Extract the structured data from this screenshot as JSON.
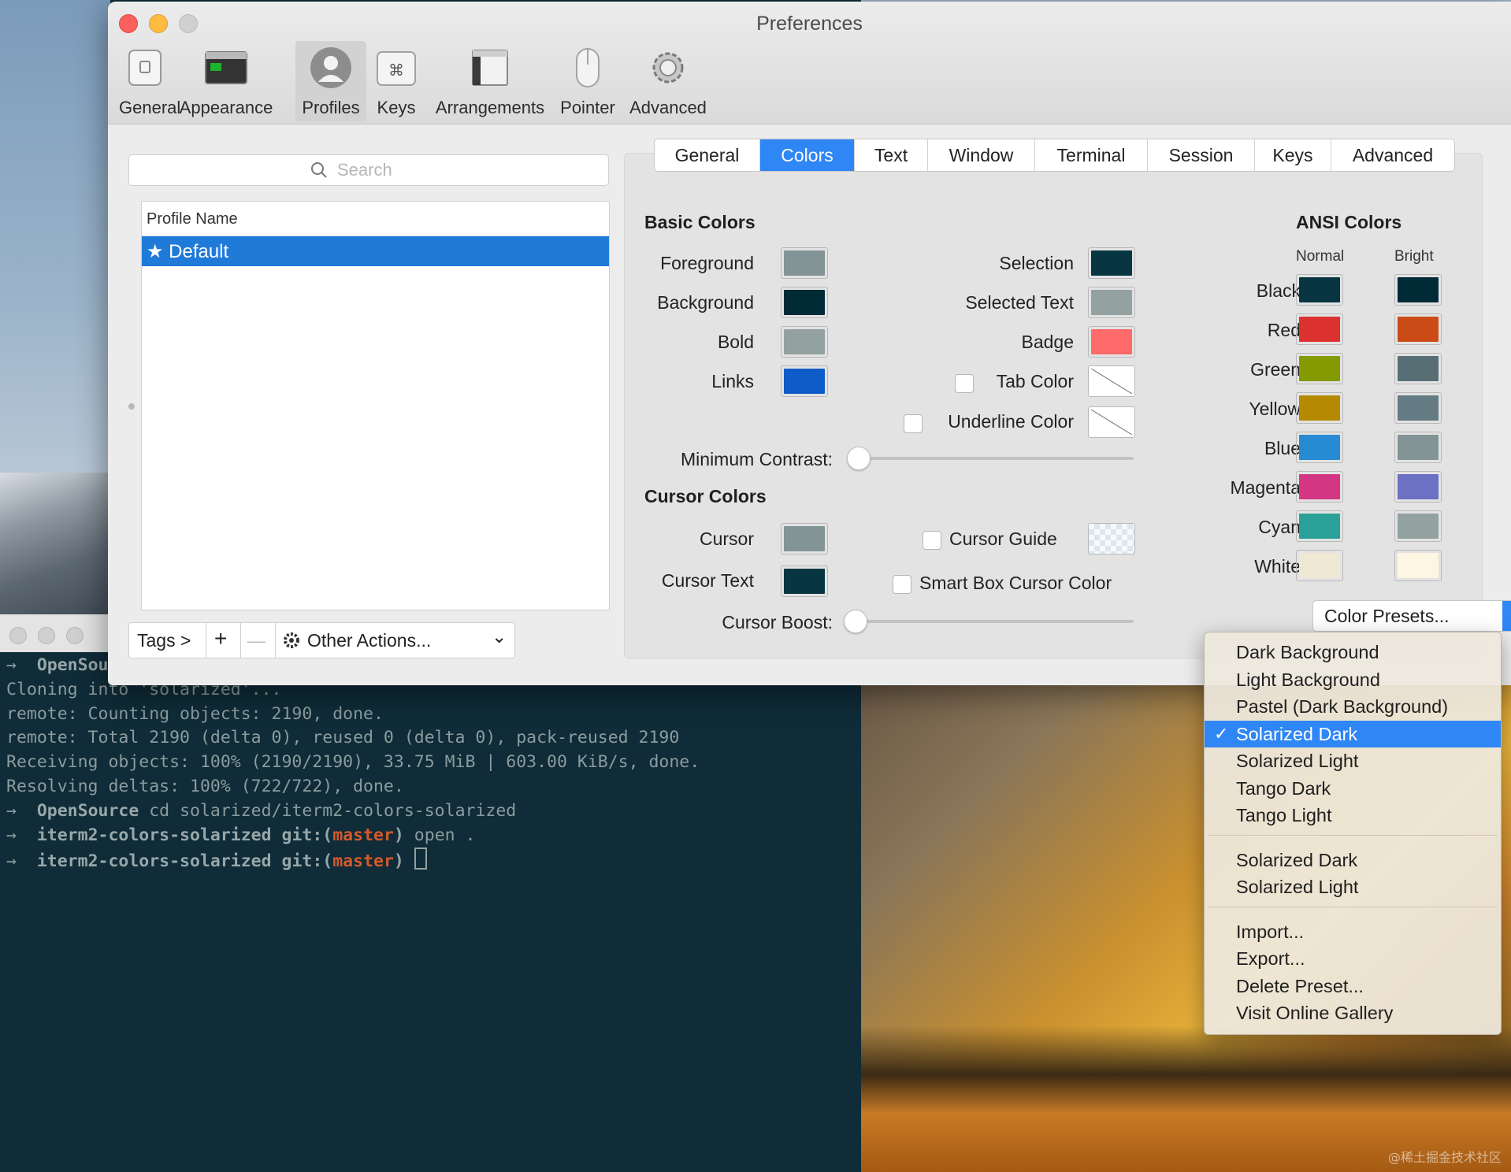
{
  "window": {
    "title": "Preferences"
  },
  "toolbar": {
    "items": [
      {
        "label": "General",
        "icon": "general-icon"
      },
      {
        "label": "Appearance",
        "icon": "appearance-icon"
      },
      {
        "label": "Profiles",
        "icon": "profiles-icon"
      },
      {
        "label": "Keys",
        "icon": "keys-icon"
      },
      {
        "label": "Arrangements",
        "icon": "arrangements-icon"
      },
      {
        "label": "Pointer",
        "icon": "pointer-icon"
      },
      {
        "label": "Advanced",
        "icon": "gear-icon"
      }
    ],
    "selected": "Profiles"
  },
  "profiles": {
    "search_placeholder": "Search",
    "column_header": "Profile Name",
    "rows": [
      "★ Default"
    ],
    "tags_label": "Tags >",
    "add_label": "+",
    "remove_label": "—",
    "other_actions_label": "Other Actions...",
    "chevron": "⌄"
  },
  "tabs": {
    "items": [
      "General",
      "Colors",
      "Text",
      "Window",
      "Terminal",
      "Session",
      "Keys",
      "Advanced"
    ],
    "selected": "Colors"
  },
  "basic_colors": {
    "title": "Basic Colors",
    "left": [
      {
        "label": "Foreground",
        "color": "#839496"
      },
      {
        "label": "Background",
        "color": "#002b36"
      },
      {
        "label": "Bold",
        "color": "#93a1a1"
      },
      {
        "label": "Links",
        "color": "#0f5cc9"
      }
    ],
    "right": [
      {
        "label": "Selection",
        "color": "#073642"
      },
      {
        "label": "Selected Text",
        "color": "#93a1a1"
      },
      {
        "label": "Badge",
        "color": "#ff6a6a"
      },
      {
        "label": "Tab Color",
        "color": "none",
        "checkbox": false
      },
      {
        "label": "Underline Color",
        "color": "none",
        "checkbox": false
      }
    ],
    "min_contrast_label": "Minimum Contrast:",
    "min_contrast_value": 0
  },
  "cursor_colors": {
    "title": "Cursor Colors",
    "cursor_label": "Cursor",
    "cursor_color": "#839496",
    "cursor_text_label": "Cursor Text",
    "cursor_text_color": "#073642",
    "cursor_guide_label": "Cursor Guide",
    "cursor_guide_checked": false,
    "smart_box_label": "Smart Box Cursor Color",
    "smart_box_checked": false,
    "boost_label": "Cursor Boost:",
    "boost_value": 0
  },
  "ansi": {
    "title": "ANSI Colors",
    "normal_label": "Normal",
    "bright_label": "Bright",
    "rows": [
      {
        "label": "Black",
        "normal": "#073642",
        "bright": "#002b36"
      },
      {
        "label": "Red",
        "normal": "#dc322f",
        "bright": "#cb4b16"
      },
      {
        "label": "Green",
        "normal": "#859900",
        "bright": "#586e75"
      },
      {
        "label": "Yellow",
        "normal": "#b58900",
        "bright": "#657b83"
      },
      {
        "label": "Blue",
        "normal": "#268bd2",
        "bright": "#839496"
      },
      {
        "label": "Magenta",
        "normal": "#d33682",
        "bright": "#6c71c4"
      },
      {
        "label": "Cyan",
        "normal": "#2aa198",
        "bright": "#93a1a1"
      },
      {
        "label": "White",
        "normal": "#eee8d5",
        "bright": "#fdf6e3"
      }
    ]
  },
  "presets": {
    "button_label": "Color Presets...",
    "menu": [
      {
        "label": "Dark Background"
      },
      {
        "label": "Light Background"
      },
      {
        "label": "Pastel (Dark Background)"
      },
      {
        "label": "Solarized Dark",
        "selected": true
      },
      {
        "label": "Solarized Light"
      },
      {
        "label": "Tango Dark"
      },
      {
        "label": "Tango Light"
      },
      {
        "separator": true
      },
      {
        "label": "Solarized Dark"
      },
      {
        "label": "Solarized Light"
      },
      {
        "separator": true
      },
      {
        "label": "Import..."
      },
      {
        "label": "Export..."
      },
      {
        "label": "Delete Preset..."
      },
      {
        "label": "Visit Online Gallery"
      }
    ],
    "check": "✓"
  },
  "terminal": {
    "lines": [
      [
        {
          "t": "→  ",
          "c": "t-arrow"
        },
        {
          "t": "OpenSou",
          "c": "t-bold"
        }
      ],
      [
        {
          "t": "Cloning into 'solarized'...",
          "c": ""
        }
      ],
      [
        {
          "t": "remote: Counting objects: 2190, done.",
          "c": ""
        }
      ],
      [
        {
          "t": "remote: Total 2190 (delta 0), reused 0 (delta 0), pack-reused 2190",
          "c": ""
        }
      ],
      [
        {
          "t": "Receiving objects: 100% (2190/2190), 33.75 MiB | 603.00 KiB/s, done.",
          "c": ""
        }
      ],
      [
        {
          "t": "Resolving deltas: 100% (722/722), done.",
          "c": ""
        }
      ],
      [
        {
          "t": "→  ",
          "c": "t-arrow"
        },
        {
          "t": "OpenSource",
          "c": "t-bold"
        },
        {
          "t": " cd solarized/iterm2-colors-solarized",
          "c": ""
        }
      ],
      [
        {
          "t": "→  ",
          "c": "t-arrow"
        },
        {
          "t": "iterm2-colors-solarized",
          "c": "t-bold"
        },
        {
          "t": " git:(",
          "c": "t-bold"
        },
        {
          "t": "master",
          "c": "t-branch"
        },
        {
          "t": ")",
          "c": "t-bold"
        },
        {
          "t": " open .",
          "c": ""
        }
      ],
      [
        {
          "t": "→  ",
          "c": "t-arrow"
        },
        {
          "t": "iterm2-colors-solarized",
          "c": "t-bold"
        },
        {
          "t": " git:(",
          "c": "t-bold"
        },
        {
          "t": "master",
          "c": "t-branch"
        },
        {
          "t": ")",
          "c": "t-bold"
        },
        {
          "t": " ",
          "c": ""
        },
        {
          "t": "",
          "c": "t-cursor"
        }
      ]
    ]
  },
  "watermark": "@稀土掘金技术社区"
}
